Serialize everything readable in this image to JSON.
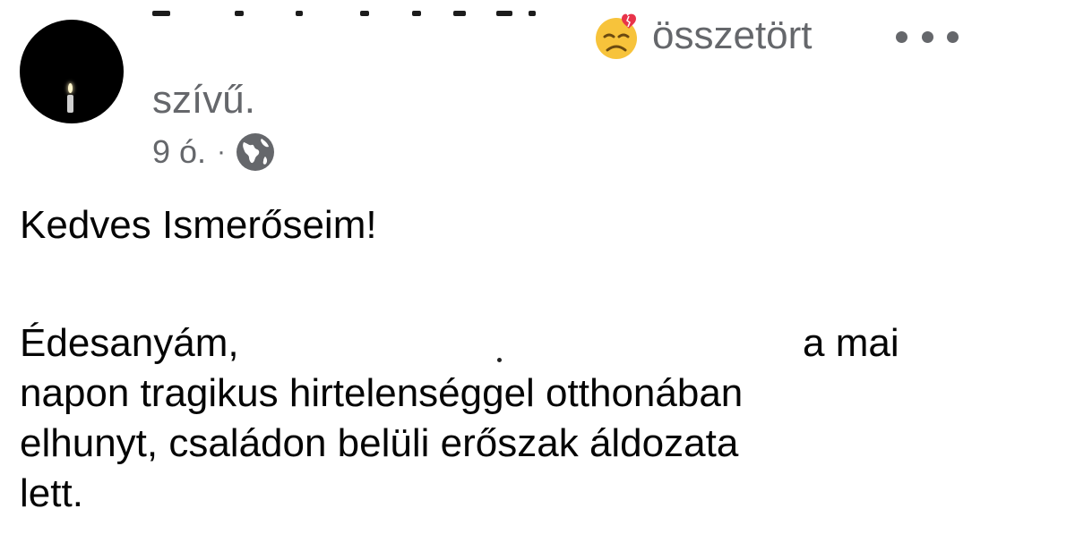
{
  "post": {
    "feeling_text_line1": "összetört",
    "feeling_text_line2": "szívű.",
    "feeling_emoji": "broken-heart-face-emoji",
    "timestamp": "9 ó.",
    "separator": "·",
    "audience_icon": "globe-icon",
    "greeting": "Kedves Ismerőseim!",
    "body_line1_start": "Édesanyám,",
    "body_line1_end": "a mai",
    "body_line2": "napon tragikus hirtelenséggel otthonában",
    "body_line3": "elhunyt, családon belüli erőszak áldozata",
    "body_line4": "lett."
  },
  "colors": {
    "secondary_text": "#65676b",
    "primary_text": "#050505",
    "avatar_background": "#000000"
  }
}
